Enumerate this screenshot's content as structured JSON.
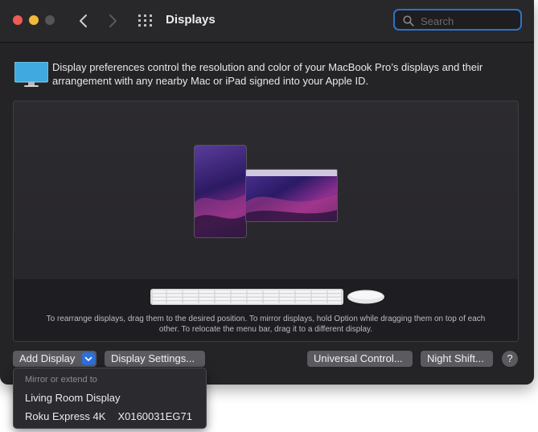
{
  "window": {
    "title": "Displays"
  },
  "search": {
    "placeholder": "Search",
    "value": ""
  },
  "intro": {
    "text": "Display preferences control the resolution and color of your MacBook Pro’s displays and their arrangement with any nearby Mac or iPad signed into your Apple ID."
  },
  "arrangement": {
    "hint": "To rearrange displays, drag them to the desired position. To mirror displays, hold Option while dragging them on top of each other. To relocate the menu bar, drag it to a different display."
  },
  "buttons": {
    "add_display": "Add Display",
    "display_settings": "Display Settings...",
    "universal_control": "Universal Control...",
    "night_shift": "Night Shift...",
    "help": "?"
  },
  "add_menu": {
    "header": "Mirror or extend to",
    "items": [
      {
        "label": "Living Room Display"
      },
      {
        "label": "Roku Express 4K",
        "serial": "X0160031EG71"
      }
    ]
  },
  "colors": {
    "accent": "#2c74c6",
    "window_bg": "#242326",
    "button_bg": "#5b5a5f",
    "close": "#ee5b55",
    "minimize": "#f1b93a"
  },
  "icons": [
    "back-arrow-icon",
    "forward-arrow-icon",
    "grid-icon",
    "search-icon",
    "displays-icon",
    "chevron-down-icon",
    "keyboard-icon",
    "mouse-icon"
  ]
}
